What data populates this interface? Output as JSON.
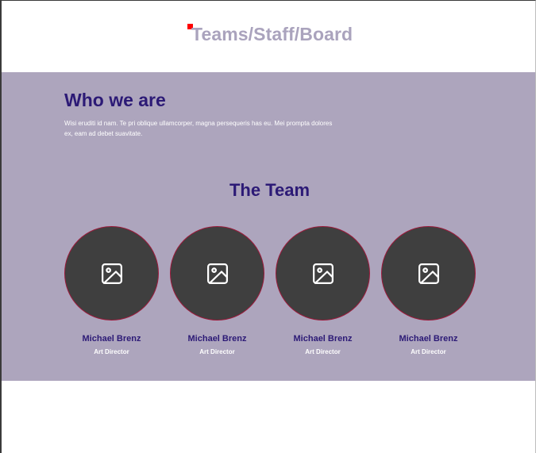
{
  "header": {
    "title": "Teams/Staff/Board"
  },
  "about": {
    "heading": "Who we are",
    "body": "Wisi eruditi id nam. Te pri oblique ullamcorper, magna persequeris has eu. Mei prompta dolores ex, eam ad debet suavitate."
  },
  "team": {
    "heading": "The Team",
    "members": [
      {
        "name": "Michael Brenz",
        "role": "Art Director",
        "icon": "image-icon"
      },
      {
        "name": "Michael Brenz",
        "role": "Art Director",
        "icon": "image-icon"
      },
      {
        "name": "Michael Brenz",
        "role": "Art Director",
        "icon": "image-icon"
      },
      {
        "name": "Michael Brenz",
        "role": "Art Director",
        "icon": "image-icon"
      }
    ]
  },
  "colors": {
    "band": "#ada5bd",
    "heading": "#2c1a76",
    "title": "#aaa3bd",
    "avatar": "#3f3f3f",
    "marker": "#ff0000"
  }
}
